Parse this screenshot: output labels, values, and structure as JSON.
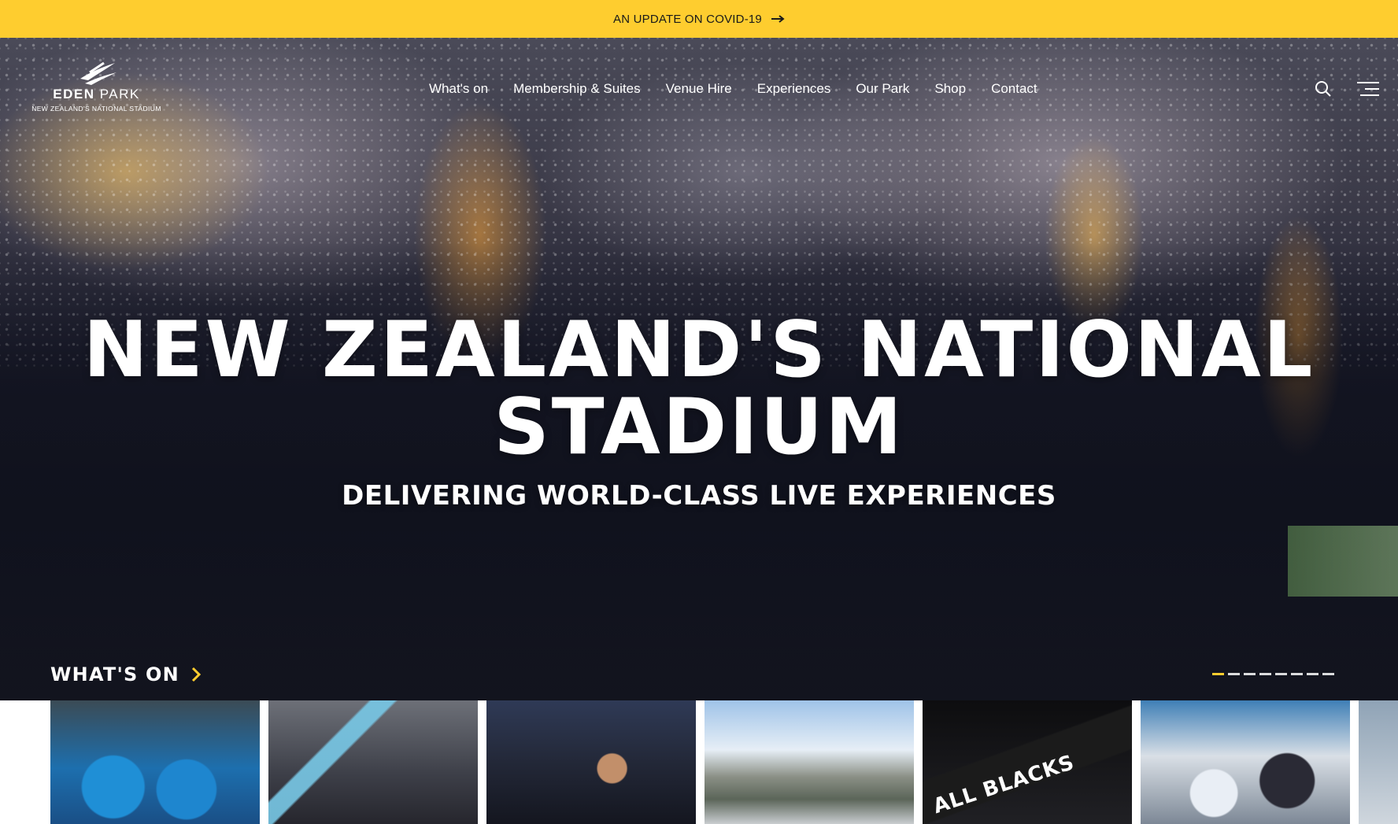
{
  "alert_bar": {
    "text": "AN UPDATE ON COVID-19",
    "icon": "arrow-right-icon",
    "background": "#fecd2f"
  },
  "logo": {
    "name_bold": "EDEN",
    "name_light": " PARK",
    "tagline": "NEW ZEALAND'S NATIONAL STADIUM"
  },
  "nav": {
    "items": [
      {
        "label": "What's on"
      },
      {
        "label": "Membership & Suites"
      },
      {
        "label": "Venue Hire"
      },
      {
        "label": "Experiences"
      },
      {
        "label": "Our Park"
      },
      {
        "label": "Shop"
      },
      {
        "label": "Contact"
      }
    ],
    "icons": [
      "search-icon",
      "menu-icon"
    ]
  },
  "hero": {
    "title_line1": "NEW ZEALAND'S NATIONAL",
    "title_line2": "STADIUM",
    "subtitle": "DELIVERING WORLD-CLASS LIVE EXPERIENCES"
  },
  "whats_on": {
    "heading": "WHAT'S ON",
    "heading_icon": "chevron-right-icon",
    "accent": "#fecd2f",
    "pager": {
      "count": 8,
      "active": 0
    },
    "cards": [
      {
        "name": "event-card-blues-rugby"
      },
      {
        "name": "event-card-fans-flags"
      },
      {
        "name": "event-card-cheering-fan"
      },
      {
        "name": "event-card-stadium-aerial"
      },
      {
        "name": "event-card-all-blacks",
        "banner": "ALL BLACKS"
      },
      {
        "name": "event-card-rugby-tackle"
      },
      {
        "name": "event-card-partial"
      }
    ]
  }
}
